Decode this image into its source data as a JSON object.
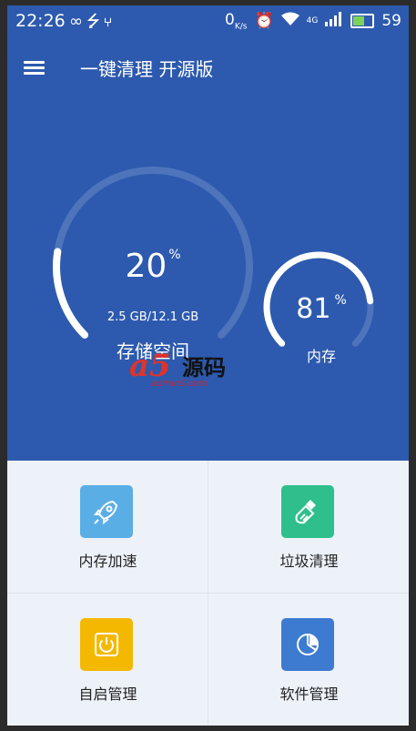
{
  "status_bar": {
    "time": "22:26",
    "network_speed": "0",
    "network_speed_unit": "K/s",
    "signal_type": "4G",
    "battery_level": "59"
  },
  "app_bar": {
    "title": "一键清理 开源版"
  },
  "storage": {
    "percent": 20,
    "percent_text": "20",
    "unit": "%",
    "usage": "2.5 GB/12.1 GB",
    "label": "存储空间"
  },
  "memory": {
    "percent": 81,
    "percent_text": "81",
    "unit": "%",
    "label": "内存"
  },
  "watermark": {
    "logo": "a5",
    "text": "源码",
    "url": "admin5.com"
  },
  "tiles": [
    {
      "label": "内存加速",
      "icon": "rocket-icon",
      "color": "#5aaee6"
    },
    {
      "label": "垃圾清理",
      "icon": "broom-icon",
      "color": "#2fbf8c"
    },
    {
      "label": "自启管理",
      "icon": "power-icon",
      "color": "#f5b800"
    },
    {
      "label": "软件管理",
      "icon": "pie-chart-icon",
      "color": "#3d7bd0"
    }
  ],
  "colors": {
    "primary": "#2d5aae",
    "grid_background": "#edf1f8"
  }
}
